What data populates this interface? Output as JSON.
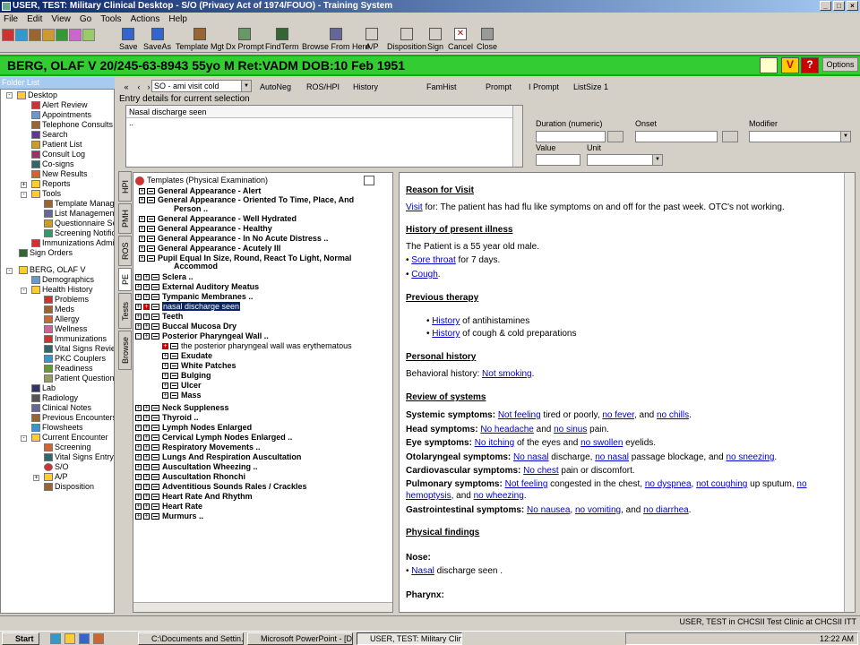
{
  "window": {
    "title": "USER, TEST: Military Clinical Desktop - S/O (Privacy Act of 1974/FOUO) - Training System"
  },
  "menu": [
    "File",
    "Edit",
    "View",
    "Go",
    "Tools",
    "Actions",
    "Help"
  ],
  "toolbar": [
    "Save",
    "SaveAs",
    "Template Mgt",
    "Dx Prompt",
    "FindTerm",
    "Browse From Here",
    "A/P",
    "Disposition",
    "Sign",
    "Cancel",
    "Close"
  ],
  "patient": {
    "banner": "BERG, OLAF V  20/245-63-8943  55yo  M   Ret:VADM  DOB:10 Feb 1951",
    "options": "Options"
  },
  "folder": {
    "header": "Folder List",
    "items": [
      "Desktop",
      "Alert Review",
      "Appointments",
      "Telephone Consults",
      "Search",
      "Patient List",
      "Consult Log",
      "Co-signs",
      "New Results",
      "Reports",
      "Tools",
      "Template Manag",
      "List Management",
      "Questionnaire Sel",
      "Screening Notific",
      "Immunizations Admin",
      "Sign Orders",
      "BERG, OLAF V",
      "Demographics",
      "Health History",
      "Problems",
      "Meds",
      "Allergy",
      "Wellness",
      "Immunizations",
      "Vital Signs Review",
      "PKC Couplers",
      "Readiness",
      "Patient Question",
      "Lab",
      "Radiology",
      "Clinical Notes",
      "Previous Encounters",
      "Flowsheets",
      "Current Encounter",
      "Screening",
      "Vital Signs Entry",
      "S/O",
      "A/P",
      "Disposition"
    ]
  },
  "nav": {
    "select": "SO - ami visit cold",
    "buttons": [
      "AutoNeg",
      "ROS/HPI",
      "History",
      "FamHist",
      "Prompt",
      "I Prompt",
      "ListSize 1"
    ]
  },
  "entry": {
    "label": "Entry details for current selection",
    "heading": "Nasal discharge seen",
    "body": "..",
    "fields": {
      "duration": "Duration (numeric)",
      "onset": "Onset",
      "modifier": "Modifier",
      "value": "Value",
      "unit": "Unit"
    }
  },
  "tabs": [
    "HPI",
    "PMH",
    "ROS",
    "PE",
    "Tests",
    "Browse"
  ],
  "tree": {
    "root": "Templates (Physical Examination)",
    "nodes": [
      "General Appearance - Alert",
      "General Appearance - Oriented To Time, Place, And",
      "Person ..",
      "General Appearance - Well Hydrated",
      "General Appearance - Healthy",
      "General Appearance - In No Acute Distress ..",
      "General Appearance - Acutely Ill",
      "Pupil Equal In Size, Round, React To Light, Normal",
      "Accommod",
      "Sclera ..",
      "External Auditory Meatus",
      "Tympanic Membranes ..",
      "nasal discharge seen",
      "Teeth",
      "Buccal Mucosa Dry",
      "Posterior Pharyngeal Wall ..",
      "the posterior pharyngeal wall was erythematous",
      "Exudate",
      "White Patches",
      "Bulging",
      "Ulcer",
      "Mass",
      "Neck Suppleness",
      "Thyroid ..",
      "Lymph Nodes Enlarged",
      "Cervical Lymph Nodes Enlarged ..",
      "Respiratory Movements ..",
      "Lungs And Respiration Auscultation",
      "Auscultation Wheezing ..",
      "Auscultation Rhonchi",
      "Adventitious Sounds Rales / Crackles",
      "Heart Rate And Rhythm",
      "Heart Rate",
      "Murmurs .."
    ]
  },
  "report": {
    "reason_h": "Reason for Visit",
    "reason": {
      "link": "Visit",
      "text": " for: The patient has had flu like symptoms on and off for the past week. OTC's not working."
    },
    "hpi_h": "History of present illness",
    "hpi_1": "The Patient is a 55 year old male.",
    "hpi_2": {
      "bullet": "• ",
      "link": "Sore throat",
      "text": " for 7 days."
    },
    "hpi_3": {
      "bullet": "• ",
      "link": "Cough",
      "text": "."
    },
    "prev_h": "Previous therapy",
    "prev_1": {
      "bullet": "• ",
      "link": "History",
      "text": " of antihistamines"
    },
    "prev_2": {
      "bullet": "• ",
      "link": "History",
      "text": " of cough & cold preparations"
    },
    "pers_h": "Personal history",
    "pers": {
      "text": "Behavioral history: ",
      "link": "Not smoking",
      "end": "."
    },
    "ros_h": "Review of systems",
    "ros": {
      "sys": {
        "label": "Systemic symptoms:",
        "l1": "Not feeling",
        "t1": " tired or poorly, ",
        "l2": "no fever",
        "t2": ", and ",
        "l3": "no chills",
        "t3": "."
      },
      "head": {
        "label": "Head symptoms:",
        "l1": "No headache",
        "t1": " and ",
        "l2": "no sinus",
        "t2": " pain."
      },
      "eye": {
        "label": "Eye symptoms:",
        "l1": "No itching",
        "t1": " of the eyes and ",
        "l2": "no swollen",
        "t2": " eyelids."
      },
      "oto": {
        "label": "Otolaryngeal symptoms:",
        "l1": "No nasal",
        "t1": " discharge, ",
        "l2": "no nasal",
        "t2": " passage blockage, and ",
        "l3": "no sneezing",
        "t3": "."
      },
      "cardio": {
        "label": "Cardiovascular symptoms:",
        "l1": "No chest",
        "t1": " pain or discomfort."
      },
      "pulm": {
        "label": "Pulmonary symptoms:",
        "l1": "Not feeling",
        "t1": " congested in the chest, ",
        "l2": "no dyspnea",
        "t2": ", ",
        "l3": "not coughing",
        "t3": " up sputum, ",
        "l4": "no",
        "l5": "hemoptysis",
        "t5": ", and ",
        "l6": "no wheezing",
        "t6": "."
      },
      "gi": {
        "label": "Gastrointestinal symptoms:",
        "l1": "No nausea",
        "t1": ", ",
        "l2": "no vomiting",
        "t2": ", and ",
        "l3": "no diarrhea",
        "t3": "."
      }
    },
    "pf_h": "Physical findings",
    "nose_h": "Nose:",
    "nose": {
      "bullet": "• ",
      "link": "Nasal",
      "text": " discharge seen ."
    },
    "pharynx_h": "Pharynx:"
  },
  "status": "USER, TEST in CHCSII Test Clinic at CHCSII ITT",
  "taskbar": {
    "start": "Start",
    "tasks": [
      "C:\\Documents and Settin...",
      "Microsoft PowerPoint - [D...",
      "USER, TEST: Military Clini..."
    ],
    "clock": "12:22 AM"
  }
}
